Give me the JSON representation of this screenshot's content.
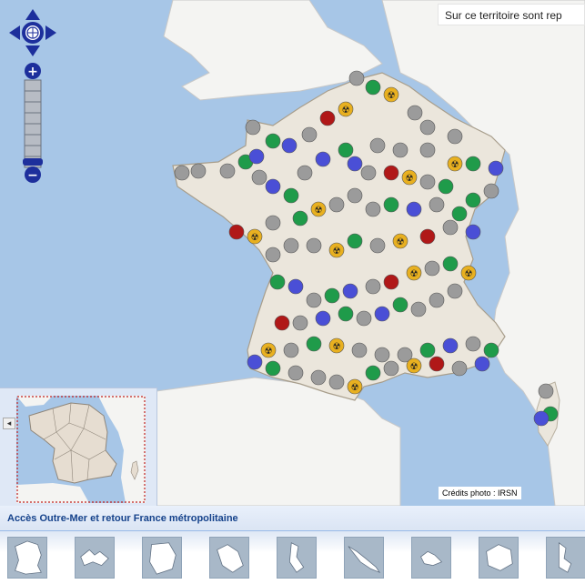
{
  "map": {
    "tooltip_text": "Sur ce territoire sont rep",
    "credit_text": "Crédits photo : IRSN",
    "colors": {
      "sea": "#a7c6e7",
      "land_france": "#ebe6dc",
      "land_neighbors": "#f4f4f2",
      "marker_grey": "#9b9b9b",
      "marker_green": "#1f9b4a",
      "marker_blue": "#4a4fd6",
      "marker_red": "#b01818",
      "marker_nuclear": "#e8b020"
    },
    "controls": {
      "pan_icon": "compass-rose-icon",
      "zoom_in": "+",
      "zoom_out": "−"
    }
  },
  "overview": {
    "toggle_label": "◂"
  },
  "territories_bar": {
    "title": "Accès Outre-Mer et retour France métropolitaine",
    "items": [
      {
        "name": "france-metropolitaine",
        "icon": "france-map-icon"
      },
      {
        "name": "guadeloupe",
        "icon": "guadeloupe-map-icon"
      },
      {
        "name": "guyane",
        "icon": "guyane-map-icon"
      },
      {
        "name": "martinique",
        "icon": "martinique-map-icon"
      },
      {
        "name": "mayotte",
        "icon": "mayotte-map-icon"
      },
      {
        "name": "nouvelle-caledonie",
        "icon": "nouvelle-caledonie-map-icon"
      },
      {
        "name": "polynesie",
        "icon": "polynesie-map-icon"
      },
      {
        "name": "reunion",
        "icon": "reunion-map-icon"
      },
      {
        "name": "saint-pierre-miquelon",
        "icon": "saint-pierre-map-icon"
      }
    ]
  }
}
